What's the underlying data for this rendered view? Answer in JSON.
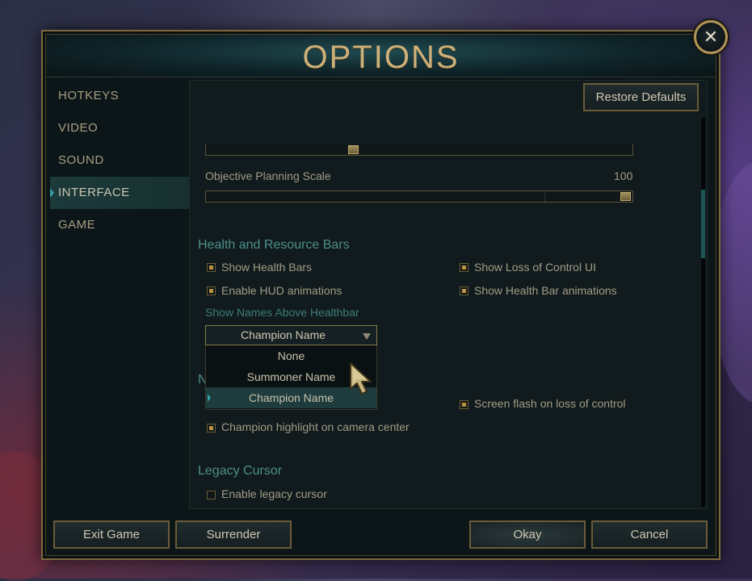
{
  "window": {
    "title": "OPTIONS",
    "close_icon": "close-icon"
  },
  "sidebar": {
    "items": [
      {
        "label": "HOTKEYS",
        "active": false
      },
      {
        "label": "VIDEO",
        "active": false
      },
      {
        "label": "SOUND",
        "active": false
      },
      {
        "label": "INTERFACE",
        "active": true
      },
      {
        "label": "GAME",
        "active": false
      }
    ]
  },
  "content": {
    "restore_defaults_label": "Restore Defaults",
    "slider_top": {
      "value_fraction": 0.34
    },
    "objective_planning_scale": {
      "label": "Objective Planning Scale",
      "value": "100",
      "value_fraction": 1.0
    },
    "health_bars": {
      "title": "Health and Resource Bars",
      "show_health_bars": {
        "label": "Show Health Bars",
        "checked": true
      },
      "show_loss_of_control_ui": {
        "label": "Show Loss of Control UI",
        "checked": true
      },
      "enable_hud_animations": {
        "label": "Enable HUD animations",
        "checked": true
      },
      "show_health_bar_animations": {
        "label": "Show Health Bar animations",
        "checked": true
      },
      "names_label": "Show Names Above Healthbar",
      "names_dropdown": {
        "selected": "Champion Name",
        "options": [
          "None",
          "Summoner Name",
          "Champion Name"
        ]
      }
    },
    "hidden_section_initial": "N",
    "screen_flash": {
      "label": "Screen flash on loss of control",
      "checked": true
    },
    "champion_highlight": {
      "label": "Champion highlight on camera center",
      "checked": true
    },
    "legacy_cursor": {
      "title": "Legacy Cursor",
      "enable_legacy_cursor": {
        "label": "Enable legacy cursor",
        "checked": false
      }
    }
  },
  "footer": {
    "exit_game": "Exit Game",
    "surrender": "Surrender",
    "okay": "Okay",
    "cancel": "Cancel"
  },
  "colors": {
    "gold_border": "#7d6a3e",
    "title_gold": "#cdb07a",
    "teal_accent": "#4d8f8b",
    "check_fill": "#b8963f"
  }
}
